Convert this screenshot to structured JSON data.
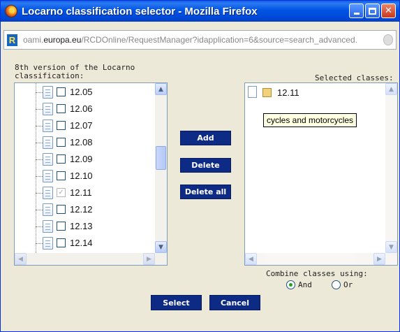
{
  "window": {
    "title": "Locarno classification selector - Mozilla Firefox"
  },
  "address": {
    "url_prefix": "oami.",
    "url_domain": "europa.eu",
    "url_path": "/RCDOnline/RequestManager?idapplication=6&source=search_advanced."
  },
  "left_panel": {
    "caption": "8th version of the Locarno classification:",
    "items": [
      {
        "code": "12.05",
        "checked": false
      },
      {
        "code": "12.06",
        "checked": false
      },
      {
        "code": "12.07",
        "checked": false
      },
      {
        "code": "12.08",
        "checked": false
      },
      {
        "code": "12.09",
        "checked": false
      },
      {
        "code": "12.10",
        "checked": false
      },
      {
        "code": "12.11",
        "checked": true
      },
      {
        "code": "12.12",
        "checked": false
      },
      {
        "code": "12.13",
        "checked": false
      },
      {
        "code": "12.14",
        "checked": false
      }
    ]
  },
  "actions": {
    "add": "Add",
    "delete": "Delete",
    "delete_all": "Delete all"
  },
  "right_panel": {
    "caption": "Selected classes:",
    "items": [
      {
        "code": "12.11"
      }
    ],
    "tooltip": "cycles and motorcycles"
  },
  "combine": {
    "label": "Combine classes using:",
    "options": [
      {
        "label": "And",
        "selected": true
      },
      {
        "label": "Or",
        "selected": false
      }
    ]
  },
  "footer": {
    "select": "Select",
    "cancel": "Cancel"
  },
  "colors": {
    "titlebar": "#0054e3",
    "button": "#0d2a85",
    "tooltip_bg": "#ffffe1"
  }
}
